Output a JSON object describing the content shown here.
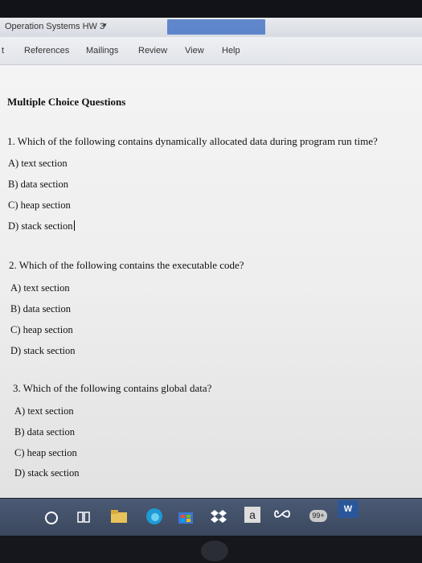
{
  "window": {
    "title": "Operation Systems HW 3",
    "title_caret": "▾"
  },
  "ribbon": {
    "left_fragment": "t",
    "tabs": [
      "References",
      "Mailings",
      "Review",
      "View",
      "Help"
    ]
  },
  "document": {
    "heading": "Multiple Choice Questions",
    "questions": [
      {
        "text": "1. Which of the following contains dynamically allocated data during program run time?",
        "options": [
          "A) text section",
          "B) data section",
          "C) heap section",
          "D) stack section"
        ]
      },
      {
        "text": "2. Which of the following contains the executable code?",
        "options": [
          "A) text section",
          "B) data section",
          "C) heap section",
          "D) stack section"
        ]
      },
      {
        "text": "3. Which of the following contains global data?",
        "options": [
          "A) text section",
          "B) data section",
          "C) heap section",
          "D) stack section"
        ]
      }
    ]
  },
  "taskbar": {
    "icons": [
      "cortana-circle-icon",
      "task-view-icon",
      "file-explorer-icon",
      "edge-icon",
      "store-icon",
      "dropbox-icon",
      "amazon-icon",
      "infinity-icon",
      "notification-badge-icon",
      "word-icon"
    ],
    "amazon_letter": "a",
    "badge_count": "99+",
    "word_letter": "W"
  },
  "colors": {
    "taskbar": "#3f4c63",
    "signin_accent": "#3f6fc4"
  }
}
